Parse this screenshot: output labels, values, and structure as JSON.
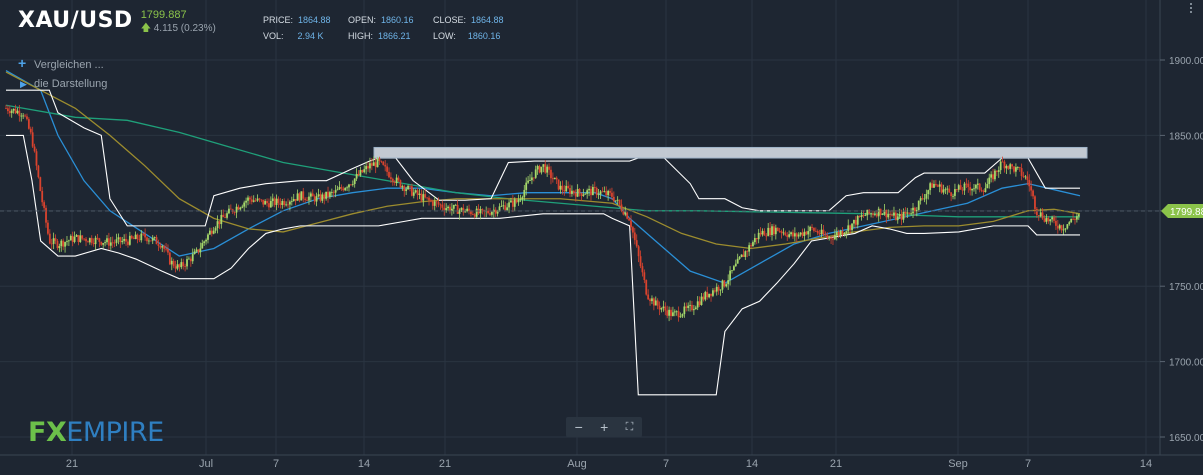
{
  "header": {
    "symbol": "XAU/USD",
    "price": "1799.887",
    "change": "4.115 (0.23%)",
    "change_icon": "arrow-up-icon"
  },
  "stats": {
    "price_label": "PRICE:",
    "price_value": "1864.88",
    "open_label": "OPEN:",
    "open_value": "1860.16",
    "close_label": "CLOSE:",
    "close_value": "1864.88",
    "vol_label": "VOL:",
    "vol_value": "2.94 K",
    "high_label": "HIGH:",
    "high_value": "1866.21",
    "low_label": "LOW:",
    "low_value": "1860.16"
  },
  "legend": {
    "compare_label": "Vergleichen ...",
    "display_label": "die Darstellung"
  },
  "logo": {
    "fx": "FX",
    "empire": "EMPIRE"
  },
  "zoom": {
    "minus": "−",
    "plus": "+",
    "fullscreen": "⛶"
  },
  "colors": {
    "background": "#1e2632",
    "up": "#a6d96a",
    "down": "#d9432e",
    "band": "#ffffff",
    "ma_blue": "#2a8fd6",
    "ma_green": "#1fa07a",
    "ma_olive": "#9c8c2e",
    "price_tag": "#8bc34a"
  },
  "chart_data": {
    "type": "candlestick",
    "ylim": [
      1645,
      1915
    ],
    "y_ticks": [
      "1900.00",
      "1850.00",
      "1800.00",
      "1750.00",
      "1700.00",
      "1650.00"
    ],
    "x_ticks": [
      "21",
      "Jul",
      "7",
      "14",
      "21",
      "Aug",
      "7",
      "14",
      "21",
      "Sep",
      "7",
      "14"
    ],
    "last_price": "1799.88",
    "annotation": {
      "type": "rectangle",
      "y_low": 1835,
      "y_high": 1842,
      "from": "Jul 14",
      "to": "Sep 9"
    },
    "close_path": [
      [
        0,
        1868
      ],
      [
        2,
        1865
      ],
      [
        3,
        1848
      ],
      [
        4,
        1812
      ],
      [
        5,
        1780
      ],
      [
        6,
        1778
      ],
      [
        8,
        1782
      ],
      [
        10,
        1781
      ],
      [
        12,
        1779
      ],
      [
        14,
        1780
      ],
      [
        16,
        1783
      ],
      [
        18,
        1778
      ],
      [
        19,
        1766
      ],
      [
        20,
        1762
      ],
      [
        22,
        1772
      ],
      [
        24,
        1790
      ],
      [
        26,
        1800
      ],
      [
        28,
        1808
      ],
      [
        30,
        1805
      ],
      [
        32,
        1806
      ],
      [
        34,
        1810
      ],
      [
        36,
        1808
      ],
      [
        38,
        1812
      ],
      [
        40,
        1820
      ],
      [
        42,
        1830
      ],
      [
        43,
        1832
      ],
      [
        45,
        1820
      ],
      [
        47,
        1812
      ],
      [
        49,
        1806
      ],
      [
        51,
        1802
      ],
      [
        53,
        1800
      ],
      [
        55,
        1798
      ],
      [
        57,
        1802
      ],
      [
        59,
        1806
      ],
      [
        61,
        1825
      ],
      [
        62,
        1830
      ],
      [
        64,
        1815
      ],
      [
        66,
        1812
      ],
      [
        68,
        1813
      ],
      [
        70,
        1810
      ],
      [
        72,
        1795
      ],
      [
        73,
        1770
      ],
      [
        74,
        1745
      ],
      [
        75,
        1738
      ],
      [
        77,
        1731
      ],
      [
        79,
        1735
      ],
      [
        81,
        1745
      ],
      [
        83,
        1752
      ],
      [
        85,
        1770
      ],
      [
        87,
        1785
      ],
      [
        89,
        1788
      ],
      [
        91,
        1783
      ],
      [
        93,
        1788
      ],
      [
        95,
        1782
      ],
      [
        97,
        1788
      ],
      [
        99,
        1797
      ],
      [
        101,
        1800
      ],
      [
        103,
        1795
      ],
      [
        105,
        1802
      ],
      [
        107,
        1818
      ],
      [
        109,
        1812
      ],
      [
        111,
        1816
      ],
      [
        113,
        1815
      ],
      [
        115,
        1832
      ],
      [
        117,
        1826
      ],
      [
        118,
        1820
      ],
      [
        119,
        1800
      ],
      [
        120,
        1795
      ],
      [
        122,
        1789
      ],
      [
        124,
        1798
      ]
    ],
    "bands": {
      "upper": [
        [
          0,
          1880
        ],
        [
          5,
          1880
        ],
        [
          6,
          1865
        ],
        [
          9,
          1855
        ],
        [
          11,
          1850
        ],
        [
          12,
          1808
        ],
        [
          14,
          1790
        ],
        [
          17,
          1790
        ],
        [
          23,
          1790
        ],
        [
          24,
          1810
        ],
        [
          27,
          1815
        ],
        [
          30,
          1818
        ],
        [
          34,
          1820
        ],
        [
          37,
          1820
        ],
        [
          40,
          1828
        ],
        [
          42,
          1833
        ],
        [
          43,
          1835
        ],
        [
          45,
          1835
        ],
        [
          47,
          1820
        ],
        [
          50,
          1807
        ],
        [
          53,
          1807
        ],
        [
          56,
          1808
        ],
        [
          58,
          1832
        ],
        [
          61,
          1833
        ],
        [
          63,
          1833
        ],
        [
          66,
          1833
        ],
        [
          69,
          1833
        ],
        [
          72,
          1833
        ],
        [
          73,
          1835
        ],
        [
          76,
          1835
        ],
        [
          79,
          1818
        ],
        [
          80,
          1808
        ],
        [
          83,
          1808
        ],
        [
          85,
          1802
        ],
        [
          87,
          1800
        ],
        [
          89,
          1800
        ],
        [
          92,
          1800
        ],
        [
          95,
          1800
        ],
        [
          97,
          1810
        ],
        [
          99,
          1812
        ],
        [
          103,
          1812
        ],
        [
          105,
          1822
        ],
        [
          106,
          1825
        ],
        [
          110,
          1825
        ],
        [
          113,
          1825
        ],
        [
          115,
          1835
        ],
        [
          118,
          1835
        ],
        [
          120,
          1815
        ],
        [
          124,
          1815
        ]
      ],
      "lower": [
        [
          0,
          1850
        ],
        [
          2,
          1850
        ],
        [
          3,
          1820
        ],
        [
          4,
          1780
        ],
        [
          6,
          1770
        ],
        [
          8,
          1770
        ],
        [
          11,
          1775
        ],
        [
          13,
          1772
        ],
        [
          15,
          1768
        ],
        [
          18,
          1760
        ],
        [
          20,
          1755
        ],
        [
          24,
          1755
        ],
        [
          26,
          1762
        ],
        [
          28,
          1775
        ],
        [
          30,
          1785
        ],
        [
          32,
          1788
        ],
        [
          34,
          1790
        ],
        [
          40,
          1790
        ],
        [
          43,
          1790
        ],
        [
          46,
          1793
        ],
        [
          48,
          1795
        ],
        [
          52,
          1795
        ],
        [
          57,
          1795
        ],
        [
          62,
          1798
        ],
        [
          66,
          1798
        ],
        [
          69,
          1798
        ],
        [
          70,
          1795
        ],
        [
          72,
          1790
        ],
        [
          73,
          1678
        ],
        [
          75,
          1678
        ],
        [
          82,
          1678
        ],
        [
          83,
          1720
        ],
        [
          85,
          1735
        ],
        [
          87,
          1740
        ],
        [
          89,
          1752
        ],
        [
          91,
          1765
        ],
        [
          93,
          1780
        ],
        [
          96,
          1783
        ],
        [
          98,
          1785
        ],
        [
          100,
          1790
        ],
        [
          102,
          1788
        ],
        [
          104,
          1785
        ],
        [
          106,
          1785
        ],
        [
          110,
          1786
        ],
        [
          114,
          1790
        ],
        [
          116,
          1790
        ],
        [
          118,
          1790
        ],
        [
          119,
          1784
        ],
        [
          124,
          1784
        ]
      ]
    },
    "moving_averages": [
      {
        "color_key": "ma_blue",
        "points": [
          [
            0,
            1893
          ],
          [
            4,
            1880
          ],
          [
            6,
            1850
          ],
          [
            9,
            1820
          ],
          [
            12,
            1800
          ],
          [
            16,
            1785
          ],
          [
            20,
            1770
          ],
          [
            24,
            1775
          ],
          [
            28,
            1788
          ],
          [
            32,
            1800
          ],
          [
            36,
            1808
          ],
          [
            40,
            1812
          ],
          [
            44,
            1815
          ],
          [
            48,
            1815
          ],
          [
            52,
            1812
          ],
          [
            56,
            1810
          ],
          [
            60,
            1812
          ],
          [
            64,
            1812
          ],
          [
            68,
            1812
          ],
          [
            70,
            1808
          ],
          [
            72,
            1795
          ],
          [
            75,
            1780
          ],
          [
            79,
            1760
          ],
          [
            83,
            1752
          ],
          [
            87,
            1765
          ],
          [
            91,
            1778
          ],
          [
            95,
            1785
          ],
          [
            99,
            1790
          ],
          [
            103,
            1795
          ],
          [
            107,
            1800
          ],
          [
            111,
            1805
          ],
          [
            115,
            1815
          ],
          [
            118,
            1818
          ],
          [
            121,
            1814
          ],
          [
            124,
            1810
          ]
        ]
      },
      {
        "color_key": "ma_green",
        "points": [
          [
            0,
            1870
          ],
          [
            8,
            1862
          ],
          [
            14,
            1860
          ],
          [
            20,
            1852
          ],
          [
            26,
            1842
          ],
          [
            32,
            1832
          ],
          [
            38,
            1826
          ],
          [
            42,
            1822
          ],
          [
            46,
            1818
          ],
          [
            52,
            1812
          ],
          [
            58,
            1808
          ],
          [
            62,
            1806
          ],
          [
            66,
            1804
          ],
          [
            70,
            1802
          ],
          [
            74,
            1800
          ],
          [
            80,
            1800
          ],
          [
            90,
            1799
          ],
          [
            100,
            1798
          ],
          [
            110,
            1796
          ],
          [
            118,
            1796
          ],
          [
            124,
            1796
          ]
        ]
      },
      {
        "color_key": "ma_olive",
        "points": [
          [
            0,
            1892
          ],
          [
            4,
            1880
          ],
          [
            8,
            1868
          ],
          [
            12,
            1850
          ],
          [
            16,
            1830
          ],
          [
            20,
            1808
          ],
          [
            24,
            1795
          ],
          [
            28,
            1788
          ],
          [
            32,
            1786
          ],
          [
            36,
            1792
          ],
          [
            40,
            1798
          ],
          [
            44,
            1803
          ],
          [
            48,
            1806
          ],
          [
            52,
            1808
          ],
          [
            56,
            1808
          ],
          [
            60,
            1808
          ],
          [
            64,
            1808
          ],
          [
            68,
            1806
          ],
          [
            70,
            1805
          ],
          [
            74,
            1796
          ],
          [
            78,
            1785
          ],
          [
            82,
            1778
          ],
          [
            86,
            1775
          ],
          [
            90,
            1778
          ],
          [
            94,
            1782
          ],
          [
            98,
            1786
          ],
          [
            102,
            1789
          ],
          [
            106,
            1790
          ],
          [
            110,
            1790
          ],
          [
            114,
            1793
          ],
          [
            118,
            1800
          ],
          [
            121,
            1801
          ],
          [
            124,
            1798
          ]
        ]
      }
    ]
  }
}
